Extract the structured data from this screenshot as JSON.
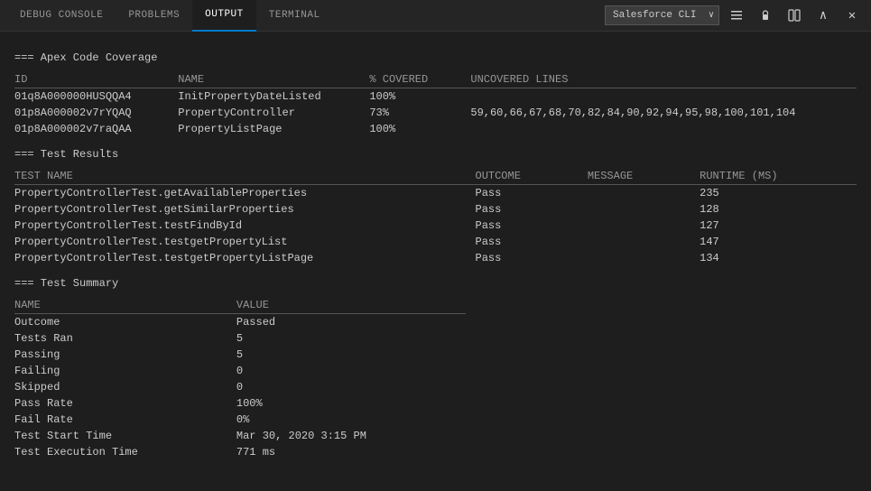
{
  "tabs": [
    {
      "id": "debug-console",
      "label": "DEBUG CONSOLE",
      "active": false
    },
    {
      "id": "problems",
      "label": "PROBLEMS",
      "active": false
    },
    {
      "id": "output",
      "label": "OUTPUT",
      "active": true
    },
    {
      "id": "terminal",
      "label": "TERMINAL",
      "active": false
    }
  ],
  "dropdown": {
    "value": "Salesforce CLI",
    "options": [
      "Salesforce CLI"
    ]
  },
  "icons": {
    "lines": "≡",
    "lock": "🔒",
    "split": "⧉",
    "chevron_up": "∧",
    "close": "✕",
    "chevron_down": "∨"
  },
  "coverage": {
    "section_header": "=== Apex Code Coverage",
    "columns": {
      "id": "ID",
      "name": "NAME",
      "pct_covered": "% COVERED",
      "uncovered_lines": "UNCOVERED LINES"
    },
    "rows": [
      {
        "id": "01q8A000000HUSQQA4",
        "name": "InitPropertyDateListed",
        "pct_covered": "100%",
        "uncovered_lines": ""
      },
      {
        "id": "01p8A000002v7rYQAQ",
        "name": "PropertyController",
        "pct_covered": "73%",
        "uncovered_lines": "59,60,66,67,68,70,82,84,90,92,94,95,98,100,101,104"
      },
      {
        "id": "01p8A000002v7raQAA",
        "name": "PropertyListPage",
        "pct_covered": "100%",
        "uncovered_lines": ""
      }
    ]
  },
  "test_results": {
    "section_header": "=== Test Results",
    "columns": {
      "test_name": "TEST NAME",
      "outcome": "OUTCOME",
      "message": "MESSAGE",
      "runtime_ms": "RUNTIME (MS)"
    },
    "rows": [
      {
        "test_name": "PropertyControllerTest.getAvailableProperties",
        "outcome": "Pass",
        "message": "",
        "runtime_ms": "235"
      },
      {
        "test_name": "PropertyControllerTest.getSimilarProperties",
        "outcome": "Pass",
        "message": "",
        "runtime_ms": "128"
      },
      {
        "test_name": "PropertyControllerTest.testFindById",
        "outcome": "Pass",
        "message": "",
        "runtime_ms": "127"
      },
      {
        "test_name": "PropertyControllerTest.testgetPropertyList",
        "outcome": "Pass",
        "message": "",
        "runtime_ms": "147"
      },
      {
        "test_name": "PropertyControllerTest.testgetPropertyListPage",
        "outcome": "Pass",
        "message": "",
        "runtime_ms": "134"
      }
    ]
  },
  "test_summary": {
    "section_header": "=== Test Summary",
    "columns": {
      "name": "NAME",
      "value": "VALUE"
    },
    "rows": [
      {
        "name": "Outcome",
        "value": "Passed"
      },
      {
        "name": "Tests Ran",
        "value": "5"
      },
      {
        "name": "Passing",
        "value": "5"
      },
      {
        "name": "Failing",
        "value": "0"
      },
      {
        "name": "Skipped",
        "value": "0"
      },
      {
        "name": "Pass Rate",
        "value": "100%"
      },
      {
        "name": "Fail Rate",
        "value": "0%"
      },
      {
        "name": "Test Start Time",
        "value": "Mar 30, 2020 3:15 PM"
      },
      {
        "name": "Test Execution Time",
        "value": "771 ms"
      }
    ]
  }
}
